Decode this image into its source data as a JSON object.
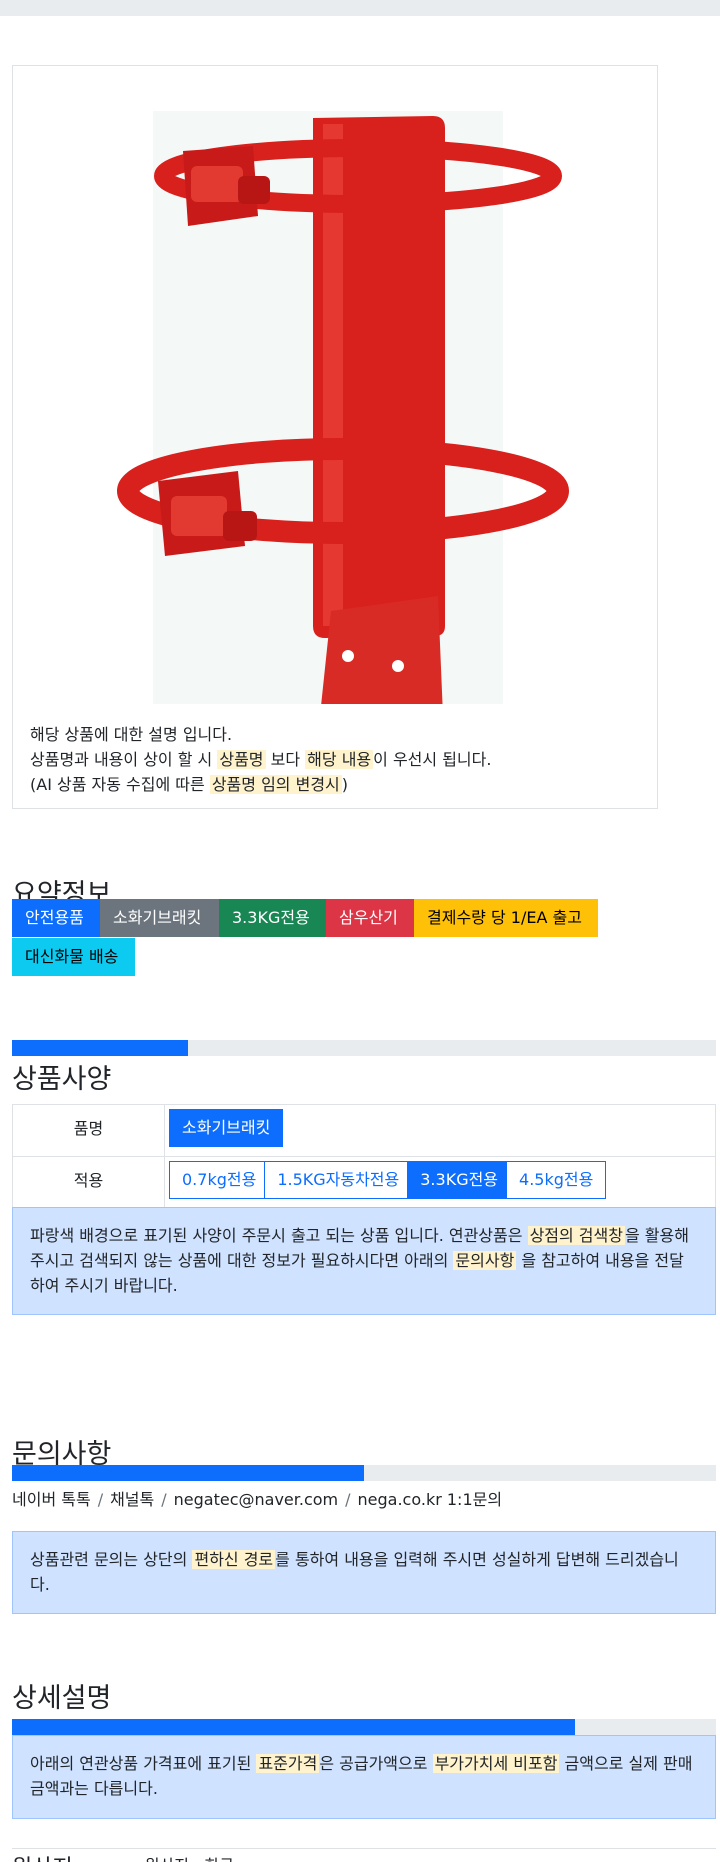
{
  "product": {
    "image_alt": "red-extinguisher-bracket",
    "desc_line1": "해당 상품에 대한 설명 입니다.",
    "desc_line2_pre": "상품명과 내용이 상이 할 시",
    "desc_line2_hl1": "상품명",
    "desc_line2_mid": "보다",
    "desc_line2_hl2": "해당 내용",
    "desc_line2_post": "이 우선시 됩니다.",
    "desc_line3_pre": "(AI 상품 자동 수집에 따른",
    "desc_line3_hl": "상품명 임의 변경시",
    "desc_line3_post": ")"
  },
  "summary": {
    "title": "요약정보",
    "tags": [
      {
        "label": "안전용품",
        "color": "#0d6efd",
        "text": "#ffffff"
      },
      {
        "label": "소화기브래킷",
        "color": "#6c757d",
        "text": "#ffffff"
      },
      {
        "label": "3.3KG전용",
        "color": "#198754",
        "text": "#ffffff"
      },
      {
        "label": "삼우산기",
        "color": "#dc3545",
        "text": "#ffffff"
      },
      {
        "label": "결제수량 당 1/EA 출고",
        "color": "#ffc107",
        "text": "#000000"
      },
      {
        "label": "대신화물 배송",
        "color": "#0dcaf0",
        "text": "#000000"
      }
    ]
  },
  "spec": {
    "title": "상품사양",
    "progress_fraction": 0.25,
    "rows": [
      {
        "label": "품명",
        "options": [
          "소화기브래킷"
        ],
        "selected": 0
      },
      {
        "label": "적용",
        "options": [
          "0.7kg전용",
          "1.5KG자동차전용",
          "3.3KG전용",
          "4.5kg전용"
        ],
        "selected": 2
      }
    ],
    "alert_pre": "파랑색 배경으로 표기된 사양이 주문시 출고 되는 상품 입니다. 연관상품은",
    "alert_hl1": "상점의 검색창",
    "alert_mid": "을 활용해 주시고 검색되지 않는 상품에 대한 정보가 필요하시다면 아래의",
    "alert_hl2": "문의사항",
    "alert_post": "을 참고하여 내용을 전달하여 주시기 바랍니다."
  },
  "inquiry": {
    "title": "문의사항",
    "progress_fraction": 0.5,
    "channels": [
      "네이버 톡톡",
      "채널톡",
      "negatec@naver.com",
      "nega.co.kr 1:1문의"
    ],
    "alert_pre": "상품관련 문의는 상단의",
    "alert_hl": "편하신 경로",
    "alert_post": "를 통하여 내용을 입력해 주시면 성실하게 답변해 드리겠습니다."
  },
  "detail": {
    "title": "상세설명",
    "progress_fraction": 0.8,
    "alert_pre": "아래의 연관상품 가격표에 표기된",
    "alert_hl1": "표준가격",
    "alert_mid": "은 공급가액으로",
    "alert_hl2": "부가가치세 비포함",
    "alert_post": "금액으로 실제 판매금액과는 다릅니다."
  },
  "origin": {
    "label": "원산지",
    "value": "- 원산지 : 한국"
  }
}
